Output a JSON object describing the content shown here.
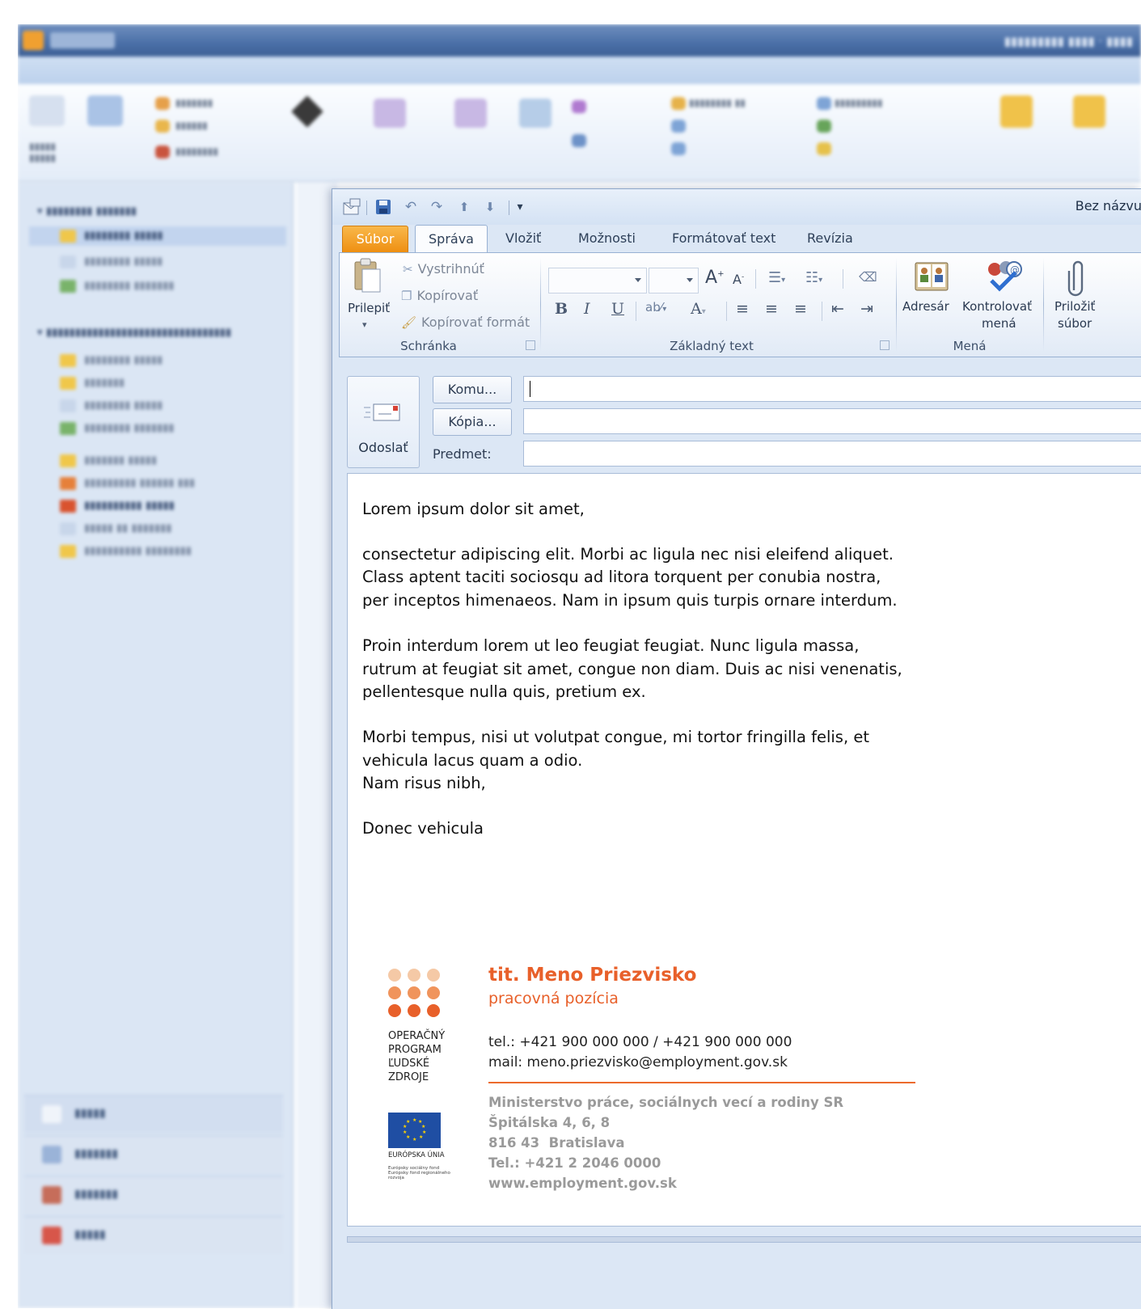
{
  "window": {
    "title": "Bez názvu"
  },
  "tabs": [
    {
      "label": "Súbor"
    },
    {
      "label": "Správa"
    },
    {
      "label": "Vložiť"
    },
    {
      "label": "Možnosti"
    },
    {
      "label": "Formátovať text"
    },
    {
      "label": "Revízia"
    }
  ],
  "ribbon": {
    "clipboard": {
      "paste": "Prilepiť",
      "cut": "Vystrihnúť",
      "copy": "Kopírovať",
      "format_painter": "Kopírovať formát",
      "group_label": "Schránka"
    },
    "basic_text": {
      "bold": "B",
      "italic": "I",
      "underline": "U",
      "grow_font": "A",
      "shrink_font": "A",
      "font_color": "A",
      "group_label": "Základný text"
    },
    "names": {
      "address_book": "Adresár",
      "check_names_line1": "Kontrolovať",
      "check_names_line2": "mená",
      "group_label": "Mená"
    },
    "include": {
      "attach_line1": "Priložiť",
      "attach_line2": "súbor"
    }
  },
  "compose": {
    "send_label": "Odoslať",
    "to_button": "Komu...",
    "cc_button": "Kópia...",
    "subject_label": "Predmet:",
    "to_value": "",
    "cc_value": "",
    "subject_value": ""
  },
  "body": {
    "paragraphs": [
      "Lorem ipsum dolor sit amet,",
      "consectetur adipiscing elit. Morbi ac ligula nec nisi eleifend aliquet.\nClass aptent taciti sociosqu ad litora torquent per conubia nostra,\nper inceptos himenaeos. Nam in ipsum quis turpis ornare interdum.",
      "Proin interdum lorem ut leo feugiat feugiat. Nunc ligula massa,\nrutrum at feugiat sit amet, congue non diam. Duis ac nisi venenatis,\npellentesque nulla quis, pretium ex.",
      "Morbi tempus, nisi ut volutpat congue, mi tortor fringilla felis, et\nvehicula lacus quam a odio.\nNam risus nibh,",
      "Donec vehicula"
    ]
  },
  "signature": {
    "name": "tit. Meno Priezvisko",
    "position": "pracovná pozícia",
    "tel": "tel.: +421 900 000 000 / +421 900 000 000",
    "mail": "mail: meno.priezvisko@employment.gov.sk",
    "org_lines": [
      "Ministerstvo práce, sociálnych vecí a rodiny SR",
      "Špitálska 4, 6, 8",
      "816 43  Bratislava",
      "Tel.: +421 2 2046 0000",
      "www.employment.gov.sk"
    ],
    "op_logo_lines": [
      "OPERAČNÝ",
      "PROGRAM",
      "ĽUDSKÉ",
      "ZDROJE"
    ],
    "eu_label": "EURÓPSKA ÚNIA",
    "eu_small": "Európsky sociálny fond Európsky fond regionálneho rozvoja",
    "accent_color": "#e8602a"
  },
  "colors": {
    "file_tab": "#ee8f12",
    "ribbon_bg": "#eef3fa",
    "window_bg": "#dce7f5"
  }
}
